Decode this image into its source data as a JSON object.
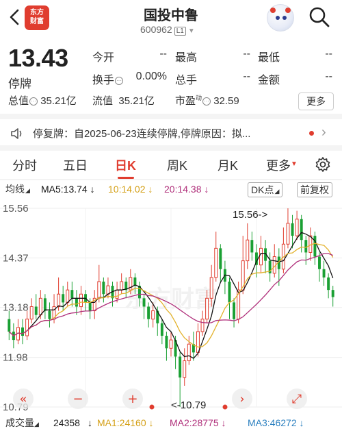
{
  "header": {
    "title": "国投中鲁",
    "code": "600962",
    "level_badge": "L1",
    "brand_line1": "东方",
    "brand_line2": "财富"
  },
  "quote": {
    "price": "13.43",
    "status": "停牌",
    "open_label": "今开",
    "open_value": "--",
    "high_label": "最高",
    "high_value": "--",
    "low_label": "最低",
    "low_value": "--",
    "turnover_label": "换手",
    "turnover_value": "0.00%",
    "volume_label": "总手",
    "volume_value": "--",
    "amount_label": "金额",
    "amount_value": "--",
    "total_cap_label": "总值",
    "total_cap_value": "35.21亿",
    "float_cap_label": "流值",
    "float_cap_value": "35.21亿",
    "pe_label": "市盈",
    "pe_sup": "动",
    "pe_value": "32.59",
    "more_label": "更多"
  },
  "notice": {
    "text": "停复牌：自2025-06-23连续停牌,停牌原因：拟..."
  },
  "tabs": [
    {
      "label": "分时"
    },
    {
      "label": "五日"
    },
    {
      "label": "日K"
    },
    {
      "label": "周K"
    },
    {
      "label": "月K"
    },
    {
      "label": "更多"
    }
  ],
  "indicators": {
    "type_label": "均线",
    "ma5": "MA5:13.74",
    "ma10": "10:14.02",
    "ma20": "20:14.38",
    "dk_label": "DK点",
    "fq_label": "前复权",
    "vol_label": "成交量",
    "vol_value": "24358",
    "vma1": "MA1:24160",
    "vma2": "MA2:28775",
    "vma3": "MA3:46272"
  },
  "colors": {
    "up": "#e03d2f",
    "down": "#1aa033",
    "ma5": "#111111",
    "ma10": "#e3b22c",
    "ma20": "#b0307b"
  },
  "chart_data": {
    "type": "candlestick",
    "y_ticks": [
      "15.56",
      "14.37",
      "13.18",
      "11.98",
      "10.79"
    ],
    "ylim": [
      10.79,
      15.56
    ],
    "max_label": "15.56->",
    "min_label": "<-10.79",
    "grid": true,
    "candles": [
      [
        12.9,
        12.6,
        13.1,
        12.4
      ],
      [
        12.6,
        12.4,
        12.8,
        12.2
      ],
      [
        12.4,
        12.7,
        12.9,
        12.3
      ],
      [
        12.7,
        12.5,
        12.9,
        12.3
      ],
      [
        12.5,
        12.9,
        13.1,
        12.4
      ],
      [
        12.9,
        13.2,
        13.4,
        12.8
      ],
      [
        13.2,
        13.0,
        13.5,
        12.9
      ],
      [
        13.0,
        13.4,
        13.6,
        12.9
      ],
      [
        13.4,
        13.1,
        13.5,
        12.9
      ],
      [
        13.1,
        12.9,
        13.3,
        12.7
      ],
      [
        12.9,
        13.2,
        13.5,
        12.8
      ],
      [
        13.2,
        13.5,
        13.9,
        13.1
      ],
      [
        13.5,
        13.3,
        13.7,
        13.1
      ],
      [
        13.3,
        13.6,
        13.8,
        13.2
      ],
      [
        13.6,
        13.4,
        13.8,
        13.2
      ],
      [
        13.4,
        13.2,
        13.6,
        13.0
      ],
      [
        13.2,
        13.5,
        13.7,
        13.0
      ],
      [
        13.5,
        13.3,
        13.6,
        13.1
      ],
      [
        13.3,
        13.1,
        13.4,
        12.9
      ],
      [
        13.1,
        13.4,
        13.6,
        12.9
      ],
      [
        13.4,
        13.8,
        14.2,
        13.3
      ],
      [
        13.8,
        13.5,
        13.9,
        13.3
      ],
      [
        13.5,
        13.7,
        13.9,
        13.4
      ],
      [
        13.7,
        13.4,
        13.8,
        13.2
      ],
      [
        13.4,
        13.6,
        13.8,
        13.3
      ],
      [
        13.6,
        13.8,
        14.0,
        13.5
      ],
      [
        13.8,
        13.6,
        13.9,
        13.4
      ],
      [
        13.6,
        13.9,
        14.1,
        13.5
      ],
      [
        13.9,
        13.7,
        14.0,
        13.5
      ],
      [
        13.7,
        13.4,
        13.8,
        13.2
      ],
      [
        13.4,
        13.2,
        13.5,
        12.9
      ],
      [
        13.2,
        12.9,
        13.3,
        12.7
      ],
      [
        12.9,
        13.1,
        13.3,
        12.7
      ],
      [
        13.1,
        12.8,
        13.2,
        12.5
      ],
      [
        12.8,
        12.5,
        12.9,
        12.3
      ],
      [
        12.5,
        12.2,
        12.6,
        11.9
      ],
      [
        12.2,
        12.4,
        12.6,
        12.0
      ],
      [
        12.4,
        12.0,
        12.5,
        11.7
      ],
      [
        12.0,
        11.5,
        12.1,
        10.79
      ],
      [
        11.5,
        11.9,
        12.2,
        11.3
      ],
      [
        11.9,
        12.3,
        12.5,
        11.8
      ],
      [
        12.3,
        12.1,
        12.6,
        11.9
      ],
      [
        12.1,
        12.6,
        12.8,
        12.0
      ],
      [
        12.6,
        12.9,
        13.1,
        12.5
      ],
      [
        12.9,
        13.4,
        13.6,
        12.8
      ],
      [
        13.4,
        13.9,
        14.2,
        13.2
      ],
      [
        13.9,
        14.6,
        15.0,
        13.8
      ],
      [
        14.6,
        14.1,
        14.7,
        13.8
      ],
      [
        14.1,
        13.8,
        14.3,
        13.5
      ],
      [
        13.8,
        13.3,
        13.9,
        12.9
      ],
      [
        13.3,
        12.9,
        13.4,
        12.7
      ],
      [
        12.9,
        13.6,
        13.8,
        12.8
      ],
      [
        13.6,
        14.3,
        14.9,
        13.5
      ],
      [
        14.3,
        14.8,
        15.2,
        14.1
      ],
      [
        14.8,
        14.5,
        15.0,
        14.3
      ],
      [
        14.5,
        14.2,
        14.7,
        13.9
      ],
      [
        14.2,
        14.6,
        14.9,
        14.0
      ],
      [
        14.6,
        14.3,
        14.8,
        14.0
      ],
      [
        14.3,
        14.0,
        14.5,
        13.8
      ],
      [
        14.0,
        14.4,
        14.7,
        13.9
      ],
      [
        14.4,
        14.1,
        14.6,
        13.7
      ],
      [
        14.1,
        14.7,
        15.1,
        14.0
      ],
      [
        14.7,
        15.2,
        15.56,
        14.6
      ],
      [
        15.2,
        14.9,
        15.4,
        14.6
      ],
      [
        14.9,
        15.3,
        15.5,
        14.8
      ],
      [
        15.3,
        14.8,
        15.4,
        14.5
      ],
      [
        14.8,
        14.5,
        14.9,
        14.2
      ],
      [
        14.5,
        14.9,
        15.1,
        14.3
      ],
      [
        14.9,
        14.4,
        15.0,
        14.2
      ],
      [
        14.4,
        14.1,
        14.5,
        13.8
      ],
      [
        14.1,
        13.9,
        14.3,
        13.7
      ],
      [
        13.9,
        13.6,
        14.0,
        13.4
      ],
      [
        13.6,
        13.43,
        13.7,
        13.2
      ]
    ]
  }
}
